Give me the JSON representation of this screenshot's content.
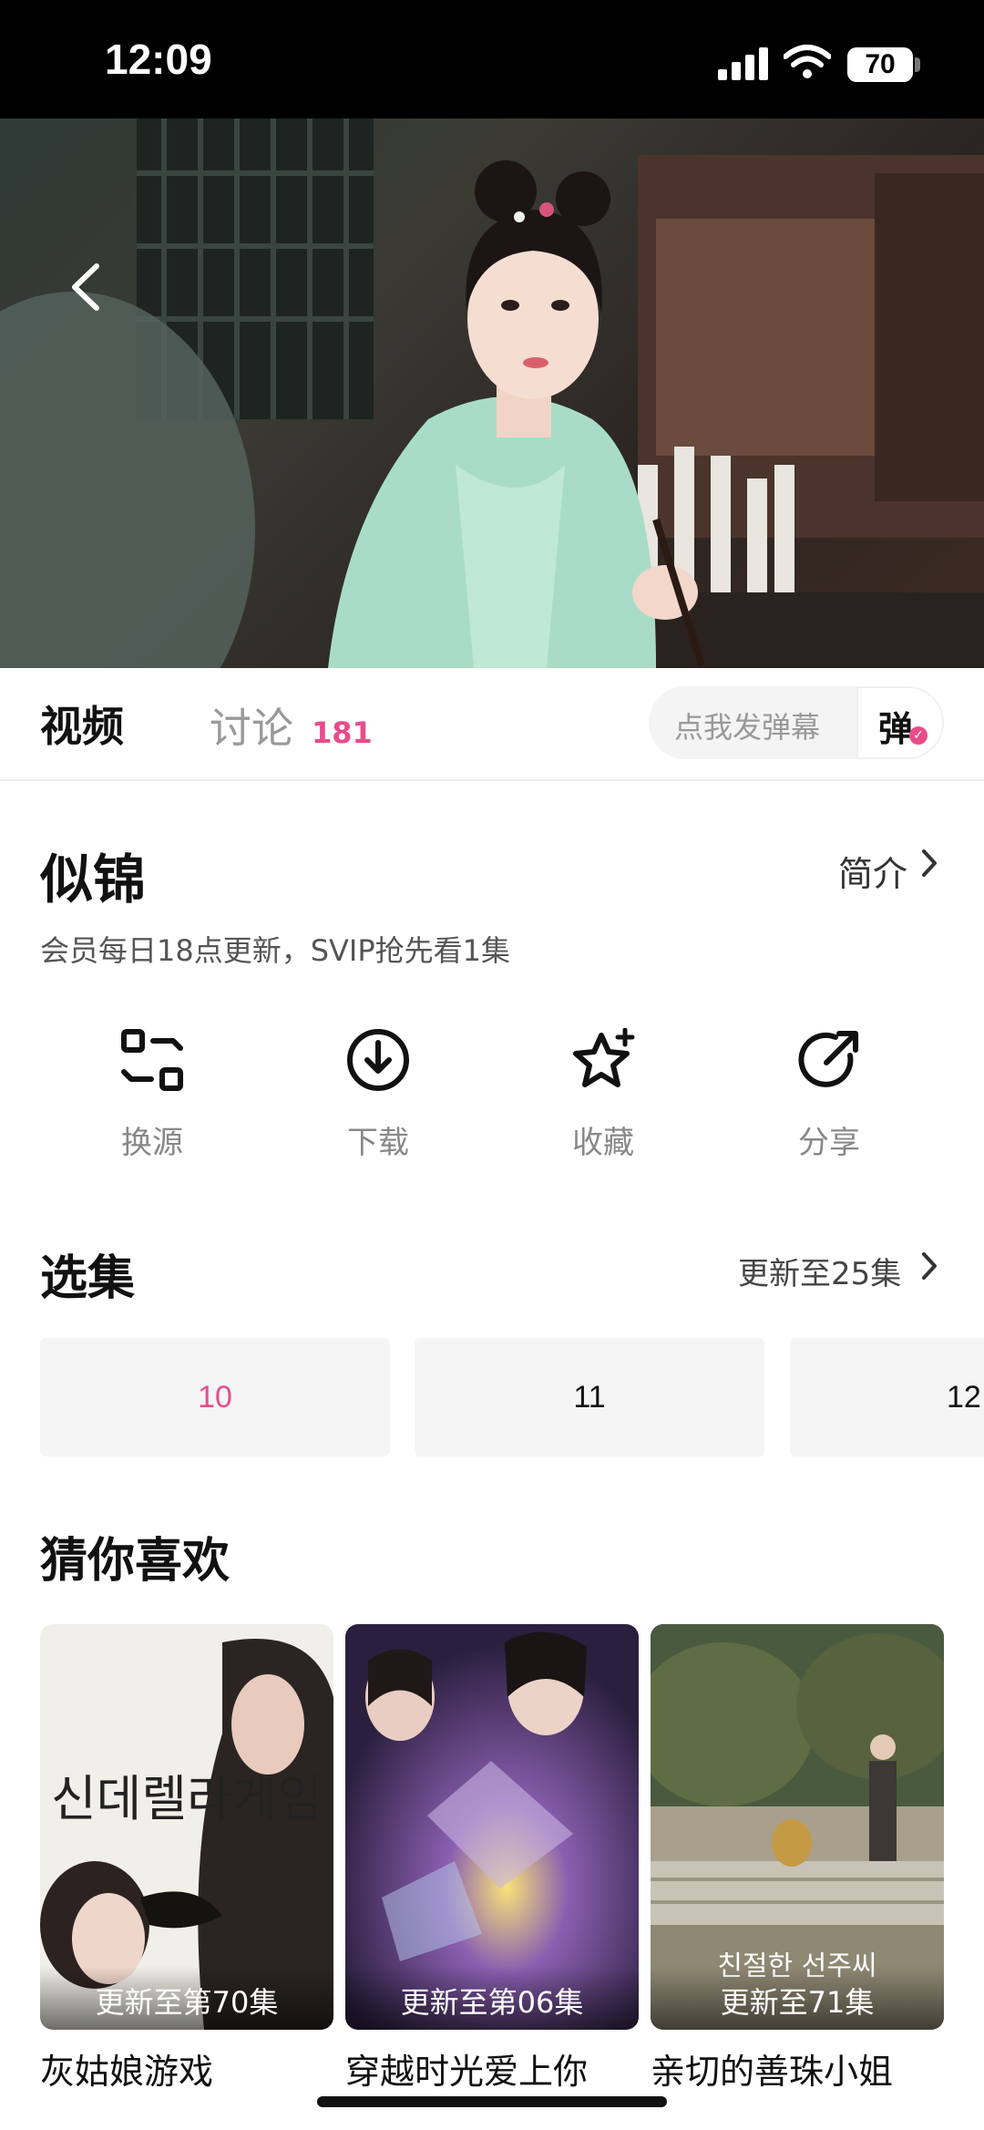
{
  "status_bar": {
    "time": "12:09",
    "battery": "70"
  },
  "tabs": {
    "video": "视频",
    "discussion": "讨论",
    "discussion_count": "181"
  },
  "danmu": {
    "placeholder": "点我发弹幕",
    "button": "弹"
  },
  "show": {
    "title": "似锦",
    "intro_label": "简介",
    "subtitle": "会员每日18点更新，SVIP抢先看1集"
  },
  "actions": [
    {
      "label": "换源",
      "icon": "switch-source-icon"
    },
    {
      "label": "下载",
      "icon": "download-icon"
    },
    {
      "label": "收藏",
      "icon": "star-icon"
    },
    {
      "label": "分享",
      "icon": "share-icon"
    }
  ],
  "episodes": {
    "title": "选集",
    "update_info": "更新至25集",
    "items": [
      "10",
      "11",
      "12"
    ],
    "selected": "10"
  },
  "recommend": {
    "title": "猜你喜欢",
    "items": [
      {
        "name": "灰姑娘游戏",
        "badge": "更新至第70集",
        "poster_text": "신데렐라게임"
      },
      {
        "name": "穿越时光爱上你",
        "badge": "更新至第06集"
      },
      {
        "name": "亲切的善珠小姐",
        "badge": "更新至71集",
        "poster_text": "친절한 선주씨"
      }
    ]
  },
  "colors": {
    "accent": "#e84c8b",
    "status_bar": "#000000"
  }
}
